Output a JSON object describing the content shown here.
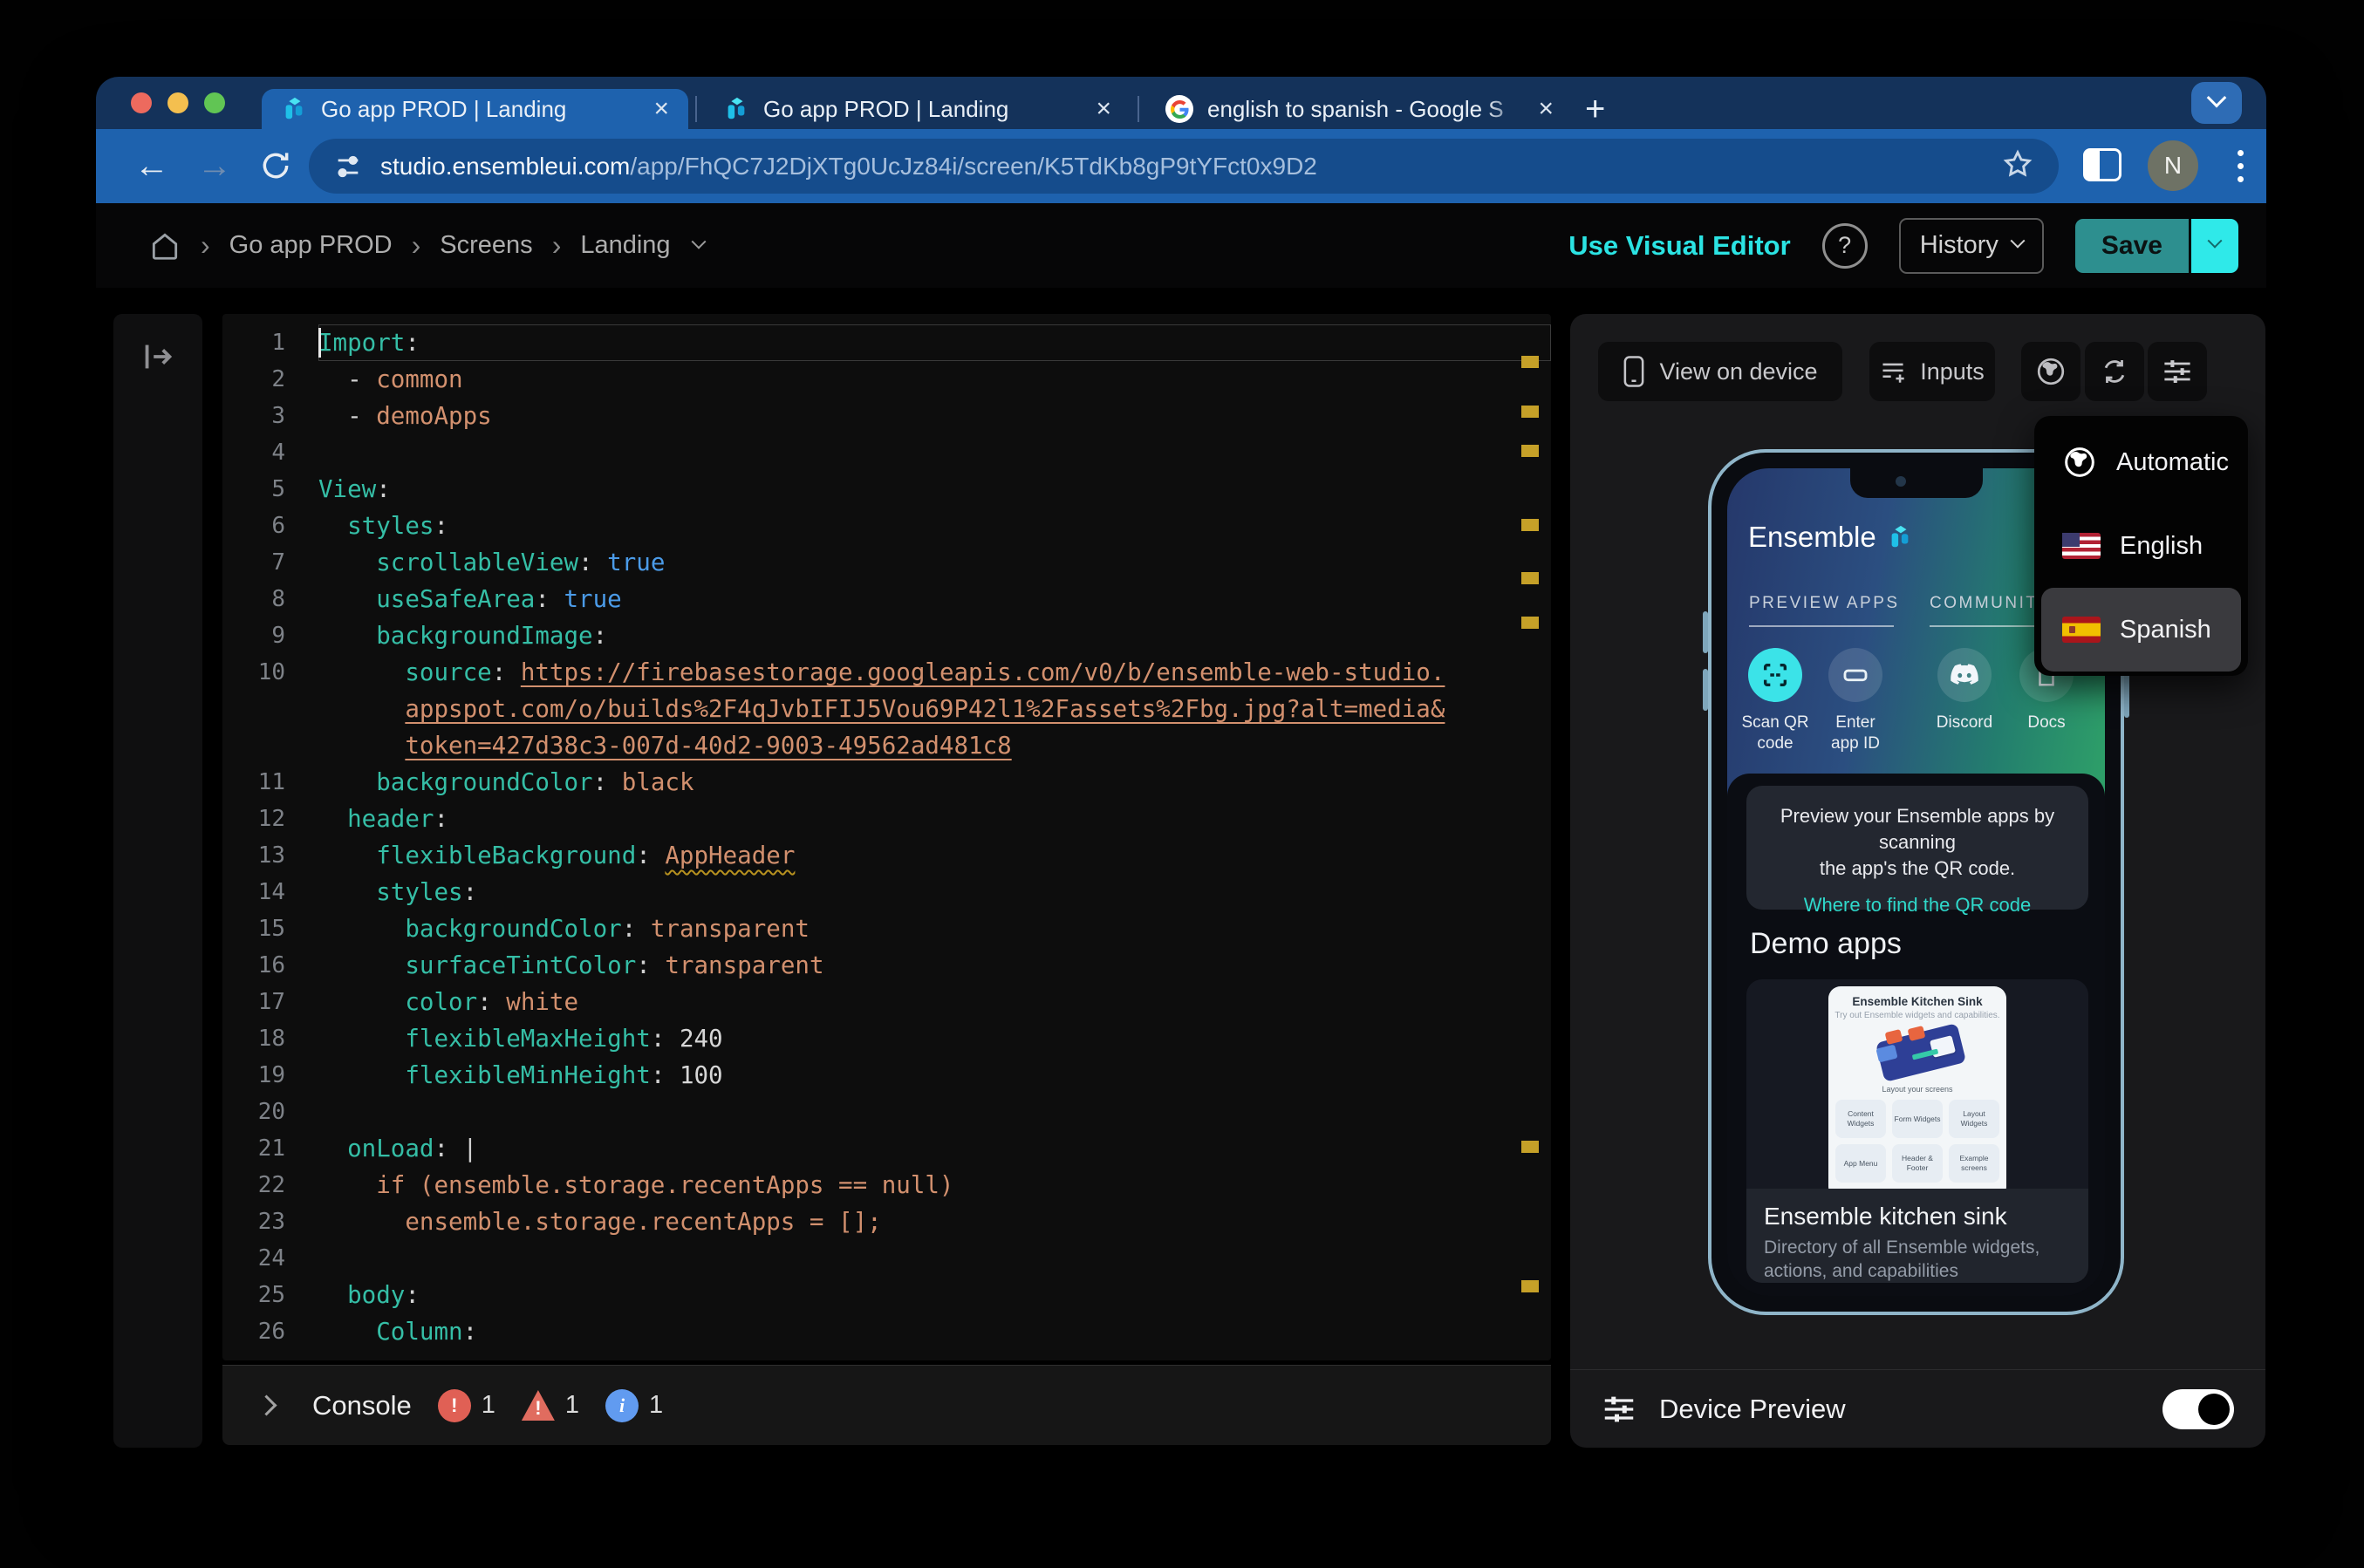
{
  "browser": {
    "tabs": [
      {
        "title": "Go app PROD | Landing",
        "icon": "ensemble",
        "active": true
      },
      {
        "title": "Go app PROD | Landing",
        "icon": "ensemble",
        "active": false
      },
      {
        "title": "english to spanish - Google S",
        "icon": "google",
        "active": false
      }
    ],
    "new_tab_label": "+",
    "url_host": "studio.ensembleui.com",
    "url_path": "/app/FhQC7J2DjXTg0UcJz84i/screen/K5TdKb8gP9tYFct0x9D2",
    "avatar_initial": "N"
  },
  "header": {
    "breadcrumbs": [
      "Go app PROD",
      "Screens",
      "Landing"
    ],
    "use_visual_editor": "Use Visual Editor",
    "help": "?",
    "history": "History",
    "save": "Save"
  },
  "editor": {
    "lines": [
      {
        "n": "1",
        "current": true,
        "seg": [
          [
            "k",
            "Import"
          ],
          [
            "p",
            ":"
          ]
        ]
      },
      {
        "n": "2",
        "seg": [
          [
            "t",
            "  - "
          ],
          [
            "s",
            "common"
          ]
        ]
      },
      {
        "n": "3",
        "seg": [
          [
            "t",
            "  - "
          ],
          [
            "s",
            "demoApps"
          ]
        ]
      },
      {
        "n": "4",
        "seg": []
      },
      {
        "n": "5",
        "seg": [
          [
            "k",
            "View"
          ],
          [
            "p",
            ":"
          ]
        ]
      },
      {
        "n": "6",
        "seg": [
          [
            "t",
            "  "
          ],
          [
            "k",
            "styles"
          ],
          [
            "p",
            ":"
          ]
        ]
      },
      {
        "n": "7",
        "seg": [
          [
            "t",
            "    "
          ],
          [
            "k",
            "scrollableView"
          ],
          [
            "p",
            ":"
          ],
          [
            "t",
            " "
          ],
          [
            "b",
            "true"
          ]
        ]
      },
      {
        "n": "8",
        "seg": [
          [
            "t",
            "    "
          ],
          [
            "k",
            "useSafeArea"
          ],
          [
            "p",
            ":"
          ],
          [
            "t",
            " "
          ],
          [
            "b",
            "true"
          ]
        ]
      },
      {
        "n": "9",
        "seg": [
          [
            "t",
            "    "
          ],
          [
            "k",
            "backgroundImage"
          ],
          [
            "p",
            ":"
          ]
        ]
      },
      {
        "n": "10",
        "seg": [
          [
            "t",
            "      "
          ],
          [
            "k",
            "source"
          ],
          [
            "p",
            ":"
          ],
          [
            "t",
            " "
          ],
          [
            "u",
            "https://firebasestorage.googleapis.com/v0/b/ensemble-web-studio."
          ]
        ]
      },
      {
        "n": "",
        "seg": [
          [
            "t",
            "      "
          ],
          [
            "u",
            "appspot.com/o/builds%2F4qJvbIFIJ5Vou69P42l1%2Fassets%2Fbg.jpg?alt=media&"
          ]
        ]
      },
      {
        "n": "",
        "seg": [
          [
            "t",
            "      "
          ],
          [
            "u",
            "token=427d38c3-007d-40d2-9003-49562ad481c8"
          ]
        ]
      },
      {
        "n": "11",
        "seg": [
          [
            "t",
            "    "
          ],
          [
            "k",
            "backgroundColor"
          ],
          [
            "p",
            ":"
          ],
          [
            "t",
            " "
          ],
          [
            "s",
            "black"
          ]
        ]
      },
      {
        "n": "12",
        "seg": [
          [
            "t",
            "  "
          ],
          [
            "k",
            "header"
          ],
          [
            "p",
            ":"
          ]
        ]
      },
      {
        "n": "13",
        "seg": [
          [
            "t",
            "    "
          ],
          [
            "k",
            "flexibleBackground"
          ],
          [
            "p",
            ":"
          ],
          [
            "t",
            " "
          ],
          [
            "w",
            "AppHeader"
          ]
        ]
      },
      {
        "n": "14",
        "seg": [
          [
            "t",
            "    "
          ],
          [
            "k",
            "styles"
          ],
          [
            "p",
            ":"
          ]
        ]
      },
      {
        "n": "15",
        "seg": [
          [
            "t",
            "      "
          ],
          [
            "k",
            "backgroundColor"
          ],
          [
            "p",
            ":"
          ],
          [
            "t",
            " "
          ],
          [
            "s",
            "transparent"
          ]
        ]
      },
      {
        "n": "16",
        "seg": [
          [
            "t",
            "      "
          ],
          [
            "k",
            "surfaceTintColor"
          ],
          [
            "p",
            ":"
          ],
          [
            "t",
            " "
          ],
          [
            "s",
            "transparent"
          ]
        ]
      },
      {
        "n": "17",
        "seg": [
          [
            "t",
            "      "
          ],
          [
            "k",
            "color"
          ],
          [
            "p",
            ":"
          ],
          [
            "t",
            " "
          ],
          [
            "s",
            "white"
          ]
        ]
      },
      {
        "n": "18",
        "seg": [
          [
            "t",
            "      "
          ],
          [
            "k",
            "flexibleMaxHeight"
          ],
          [
            "p",
            ":"
          ],
          [
            "t",
            " "
          ],
          [
            "n2",
            "240"
          ]
        ]
      },
      {
        "n": "19",
        "seg": [
          [
            "t",
            "      "
          ],
          [
            "k",
            "flexibleMinHeight"
          ],
          [
            "p",
            ":"
          ],
          [
            "t",
            " "
          ],
          [
            "n2",
            "100"
          ]
        ]
      },
      {
        "n": "20",
        "seg": []
      },
      {
        "n": "21",
        "seg": [
          [
            "t",
            "  "
          ],
          [
            "k",
            "onLoad"
          ],
          [
            "p",
            ":"
          ],
          [
            "t",
            " "
          ],
          [
            "p",
            "|"
          ]
        ]
      },
      {
        "n": "22",
        "seg": [
          [
            "t",
            "    "
          ],
          [
            "s",
            "if (ensemble.storage.recentApps == null)"
          ]
        ]
      },
      {
        "n": "23",
        "seg": [
          [
            "t",
            "      "
          ],
          [
            "s",
            "ensemble.storage.recentApps = [];"
          ]
        ]
      },
      {
        "n": "24",
        "seg": []
      },
      {
        "n": "25",
        "seg": [
          [
            "t",
            "  "
          ],
          [
            "k",
            "body"
          ],
          [
            "p",
            ":"
          ]
        ]
      },
      {
        "n": "26",
        "seg": [
          [
            "t",
            "    "
          ],
          [
            "k",
            "Column"
          ],
          [
            "p",
            ":"
          ]
        ]
      }
    ],
    "markers": [
      48,
      105,
      150,
      235,
      296,
      347,
      948,
      1108
    ]
  },
  "console": {
    "label": "Console",
    "error_count": "1",
    "warning_count": "1",
    "info_count": "1"
  },
  "panel": {
    "view_on_device": "View on device",
    "inputs": "Inputs",
    "device_preview": "Device Preview",
    "language_menu": [
      {
        "label": "Automatic",
        "icon": "globe",
        "highlighted": false
      },
      {
        "label": "English",
        "icon": "flag-us",
        "highlighted": false
      },
      {
        "label": "Spanish",
        "icon": "flag-es",
        "highlighted": true
      }
    ],
    "phone": {
      "brand": "Ensemble",
      "section_left": "PREVIEW APPS",
      "section_right": "COMMUNITY &",
      "actions": [
        {
          "label": "Scan QR\ncode",
          "icon": "qr-scan",
          "accent": true
        },
        {
          "label": "Enter\napp ID",
          "icon": "app-id",
          "accent": false
        },
        {
          "label": "Discord",
          "icon": "discord",
          "accent": false
        },
        {
          "label": "Docs",
          "icon": "docs",
          "accent": false
        }
      ],
      "qr_card_line1": "Preview your Ensemble apps by scanning",
      "qr_card_line2": "the app's the QR code.",
      "qr_card_link": "Where to find the QR code",
      "demo_heading": "Demo apps",
      "demo_card": {
        "title": "Ensemble Kitchen Sink",
        "subtitle": "Try out Ensemble widgets and capabilities.",
        "layout_label": "Layout your screens",
        "chips": [
          "Content Widgets",
          "Form Widgets",
          "Layout Widgets",
          "App Menu",
          "Header & Footer",
          "Example screens"
        ],
        "name": "Ensemble kitchen sink",
        "description": "Directory of all Ensemble widgets, actions, and capabilities"
      }
    }
  },
  "colors": {
    "accent_cyan": "#2BE3E3",
    "save_teal": "#2D8F8F",
    "error_red": "#E06055",
    "warning_marker": "#C5A028",
    "info_blue": "#619BF0",
    "active_tab_blue": "#1E62AE"
  }
}
